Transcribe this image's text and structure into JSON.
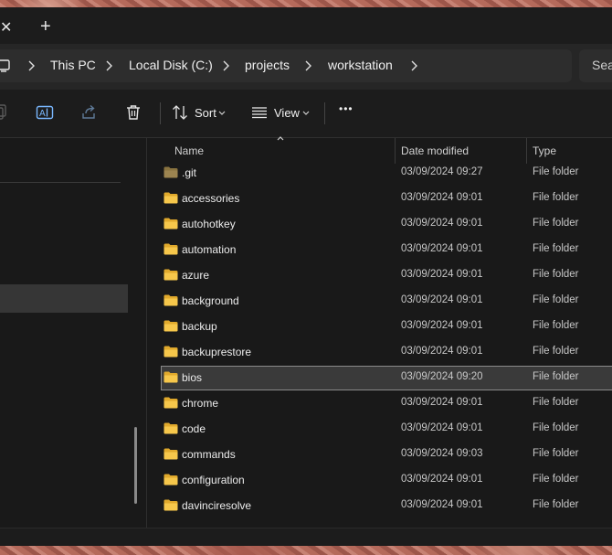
{
  "tabbar": {
    "close_glyph": "✕",
    "new_glyph": "+"
  },
  "breadcrumb": [
    "This PC",
    "Local Disk (C:)",
    "projects",
    "workstation"
  ],
  "search": {
    "placeholder": "Sea"
  },
  "toolbar": {
    "sort_label": "Sort",
    "view_label": "View",
    "more_glyph": "•••"
  },
  "columns": {
    "name": "Name",
    "date": "Date modified",
    "type": "Type"
  },
  "files": [
    {
      "name": ".git",
      "date": "03/09/2024 09:27",
      "type": "File folder",
      "hidden": true
    },
    {
      "name": "accessories",
      "date": "03/09/2024 09:01",
      "type": "File folder"
    },
    {
      "name": "autohotkey",
      "date": "03/09/2024 09:01",
      "type": "File folder"
    },
    {
      "name": "automation",
      "date": "03/09/2024 09:01",
      "type": "File folder"
    },
    {
      "name": "azure",
      "date": "03/09/2024 09:01",
      "type": "File folder"
    },
    {
      "name": "background",
      "date": "03/09/2024 09:01",
      "type": "File folder"
    },
    {
      "name": "backup",
      "date": "03/09/2024 09:01",
      "type": "File folder"
    },
    {
      "name": "backuprestore",
      "date": "03/09/2024 09:01",
      "type": "File folder"
    },
    {
      "name": "bios",
      "date": "03/09/2024 09:20",
      "type": "File folder",
      "selected": true
    },
    {
      "name": "chrome",
      "date": "03/09/2024 09:01",
      "type": "File folder"
    },
    {
      "name": "code",
      "date": "03/09/2024 09:01",
      "type": "File folder"
    },
    {
      "name": "commands",
      "date": "03/09/2024 09:03",
      "type": "File folder"
    },
    {
      "name": "configuration",
      "date": "03/09/2024 09:01",
      "type": "File folder"
    },
    {
      "name": "davinciresolve",
      "date": "03/09/2024 09:01",
      "type": "File folder"
    }
  ],
  "colors": {
    "folder": "#f6c74b",
    "folder_dark": "#e0a92c",
    "git_folder": "#8a7440",
    "accent_selected": "#3a3a3a"
  }
}
